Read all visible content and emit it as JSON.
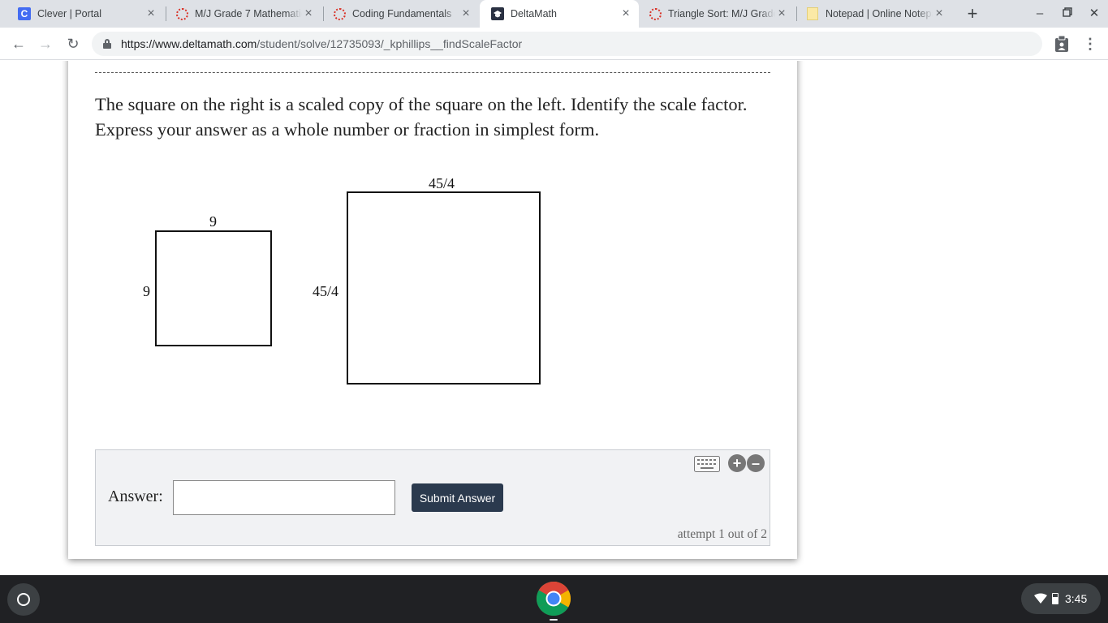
{
  "browser": {
    "tabs": [
      {
        "title": "Clever | Portal",
        "favicon": "clever-icon",
        "active": false
      },
      {
        "title": "M/J Grade 7 Mathematics",
        "favicon": "loading-ring-icon",
        "active": false
      },
      {
        "title": "Coding Fundamentals",
        "favicon": "loading-ring-icon",
        "active": false
      },
      {
        "title": "DeltaMath",
        "favicon": "deltamath-icon",
        "active": true
      },
      {
        "title": "Triangle Sort: M/J Grade 7",
        "favicon": "loading-ring-icon",
        "active": false
      },
      {
        "title": "Notepad | Online Notepad",
        "favicon": "notepad-icon",
        "active": false
      }
    ],
    "url_host": "https://www.deltamath.com",
    "url_path": "/student/solve/12735093/_kphillips__findScaleFactor"
  },
  "problem": {
    "question": "The square on the right is a scaled copy of the square on the left. Identify the scale factor. Express your answer as a whole number or fraction in simplest form.",
    "left_square": {
      "top_label": "9",
      "side_label": "9"
    },
    "right_square": {
      "top_label": "45/4",
      "side_label": "45/4"
    }
  },
  "answer": {
    "label": "Answer:",
    "value": "",
    "submit_label": "Submit Answer",
    "attempt_text": "attempt 1 out of 2"
  },
  "shelf": {
    "time": "3:45"
  },
  "colors": {
    "submit_bg": "#2b3a4e",
    "shelf_bg": "#202124"
  }
}
